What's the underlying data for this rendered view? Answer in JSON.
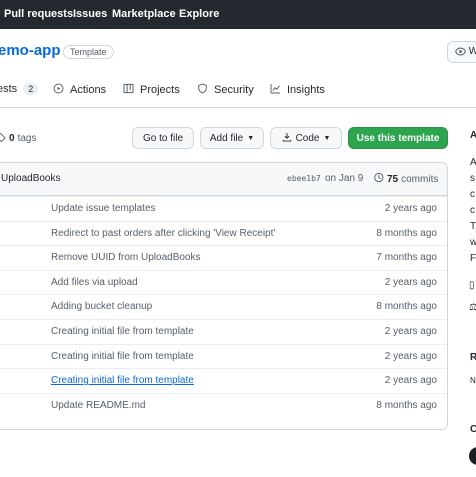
{
  "topnav": {
    "links": [
      "Pull requests",
      "Issues",
      "Marketplace",
      "Explore"
    ]
  },
  "repo": {
    "name": "emo-app",
    "badge": "Template",
    "watch_label": "W"
  },
  "tabs": [
    {
      "label": "ests",
      "counter": "2"
    },
    {
      "label": "Actions"
    },
    {
      "label": "Projects"
    },
    {
      "label": "Security"
    },
    {
      "label": "Insights"
    }
  ],
  "toolbar": {
    "tags_count": "0",
    "tags_label": "tags",
    "go_to_file": "Go to file",
    "add_file": "Add file",
    "code": "Code",
    "use_template": "Use this template"
  },
  "latest_commit": {
    "message": "UploadBooks",
    "sha": "ebee1b7",
    "date": "on Jan 9",
    "count": "75",
    "count_label": "commits"
  },
  "file_rows": [
    {
      "message": "Update issue templates",
      "age": "2 years ago",
      "link": false
    },
    {
      "message": "Redirect to past orders after clicking 'View Receipt'",
      "age": "8 months ago",
      "link": false
    },
    {
      "message": "Remove UUID from UploadBooks",
      "age": "7 months ago",
      "link": false
    },
    {
      "message": "Add files via upload",
      "age": "2 years ago",
      "link": false
    },
    {
      "message": "Adding bucket cleanup",
      "age": "8 months ago",
      "link": false
    },
    {
      "message": "Creating initial file from template",
      "age": "2 years ago",
      "link": false
    },
    {
      "message": "Creating initial file from template",
      "age": "2 years ago",
      "link": false
    },
    {
      "message": "Creating initial file from template",
      "age": "2 years ago",
      "link": true
    },
    {
      "message": "Update README.md",
      "age": "8 months ago",
      "link": false
    }
  ],
  "sidebar": {
    "fragments": [
      "A",
      "A",
      "s",
      "c",
      "c",
      "T",
      "w",
      "F",
      "R",
      "N",
      "C"
    ]
  },
  "colors": {
    "nav_bg": "#24292f",
    "accent": "#0969da",
    "primary_button": "#2da44e"
  }
}
